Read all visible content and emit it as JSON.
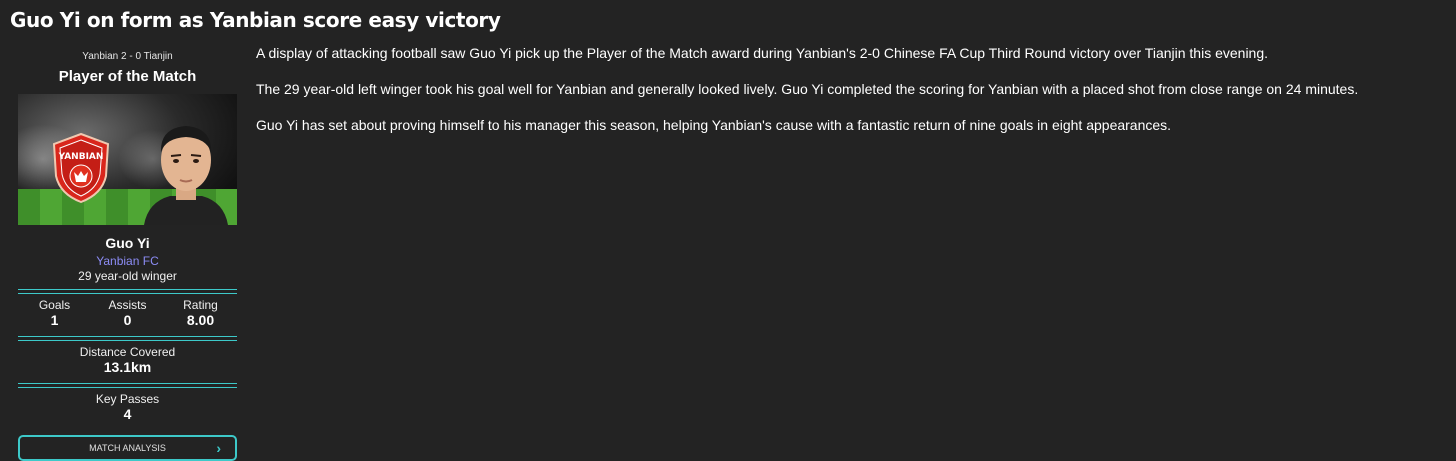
{
  "headline": "Guo Yi on form as Yanbian score easy victory",
  "panel": {
    "score_line": "Yanbian 2 - 0 Tianjin",
    "title": "Player of the Match",
    "crest_text": "YANBIAN",
    "player_name": "Guo Yi",
    "club": "Yanbian FC",
    "role": "29 year-old winger",
    "stats": [
      {
        "label": "Goals",
        "value": "1"
      },
      {
        "label": "Assists",
        "value": "0"
      },
      {
        "label": "Rating",
        "value": "8.00"
      }
    ],
    "distance": {
      "label": "Distance Covered",
      "value": "13.1km"
    },
    "key_passes": {
      "label": "Key Passes",
      "value": "4"
    },
    "button_label": "MATCH ANALYSIS"
  },
  "article": {
    "paragraphs": [
      "A display of attacking football saw Guo Yi pick up the Player of the Match award during Yanbian's 2-0 Chinese FA Cup Third Round victory over Tianjin this evening.",
      "The 29 year-old left winger took his goal well for Yanbian and generally looked lively. Guo Yi completed the scoring for Yanbian with a placed shot from close range on 24 minutes.",
      "Guo Yi has set about proving himself to his manager this season, helping Yanbian's cause with a fantastic return of nine goals in eight appearances."
    ]
  },
  "colors": {
    "background": "#232323",
    "accent": "#3dc9c9",
    "club_link": "#8c8cf5"
  }
}
